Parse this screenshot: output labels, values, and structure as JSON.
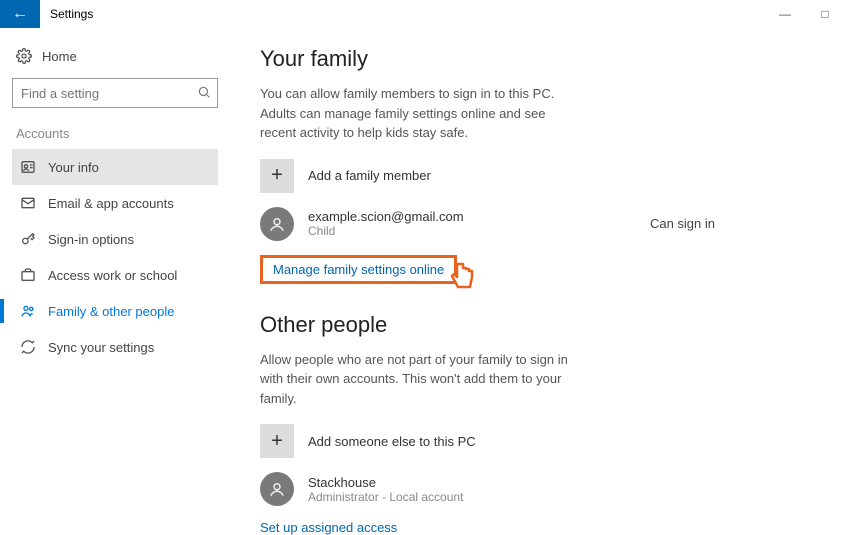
{
  "window": {
    "title": "Settings"
  },
  "sidebar": {
    "home": "Home",
    "search_placeholder": "Find a setting",
    "category": "Accounts",
    "items": [
      {
        "label": "Your info"
      },
      {
        "label": "Email & app accounts"
      },
      {
        "label": "Sign-in options"
      },
      {
        "label": "Access work or school"
      },
      {
        "label": "Family & other people"
      },
      {
        "label": "Sync your settings"
      }
    ]
  },
  "family": {
    "heading": "Your family",
    "desc": "You can allow family members to sign in to this PC. Adults can manage family settings online and see recent activity to help kids stay safe.",
    "add_label": "Add a family member",
    "member": {
      "email": "example.scion@gmail.com",
      "role": "Child",
      "status": "Can sign in"
    },
    "manage_link": "Manage family settings online"
  },
  "other": {
    "heading": "Other people",
    "desc": "Allow people who are not part of your family to sign in with their own accounts. This won't add them to your family.",
    "add_label": "Add someone else to this PC",
    "member": {
      "name": "Stackhouse",
      "role": "Administrator - Local account"
    },
    "assigned_link": "Set up assigned access"
  }
}
